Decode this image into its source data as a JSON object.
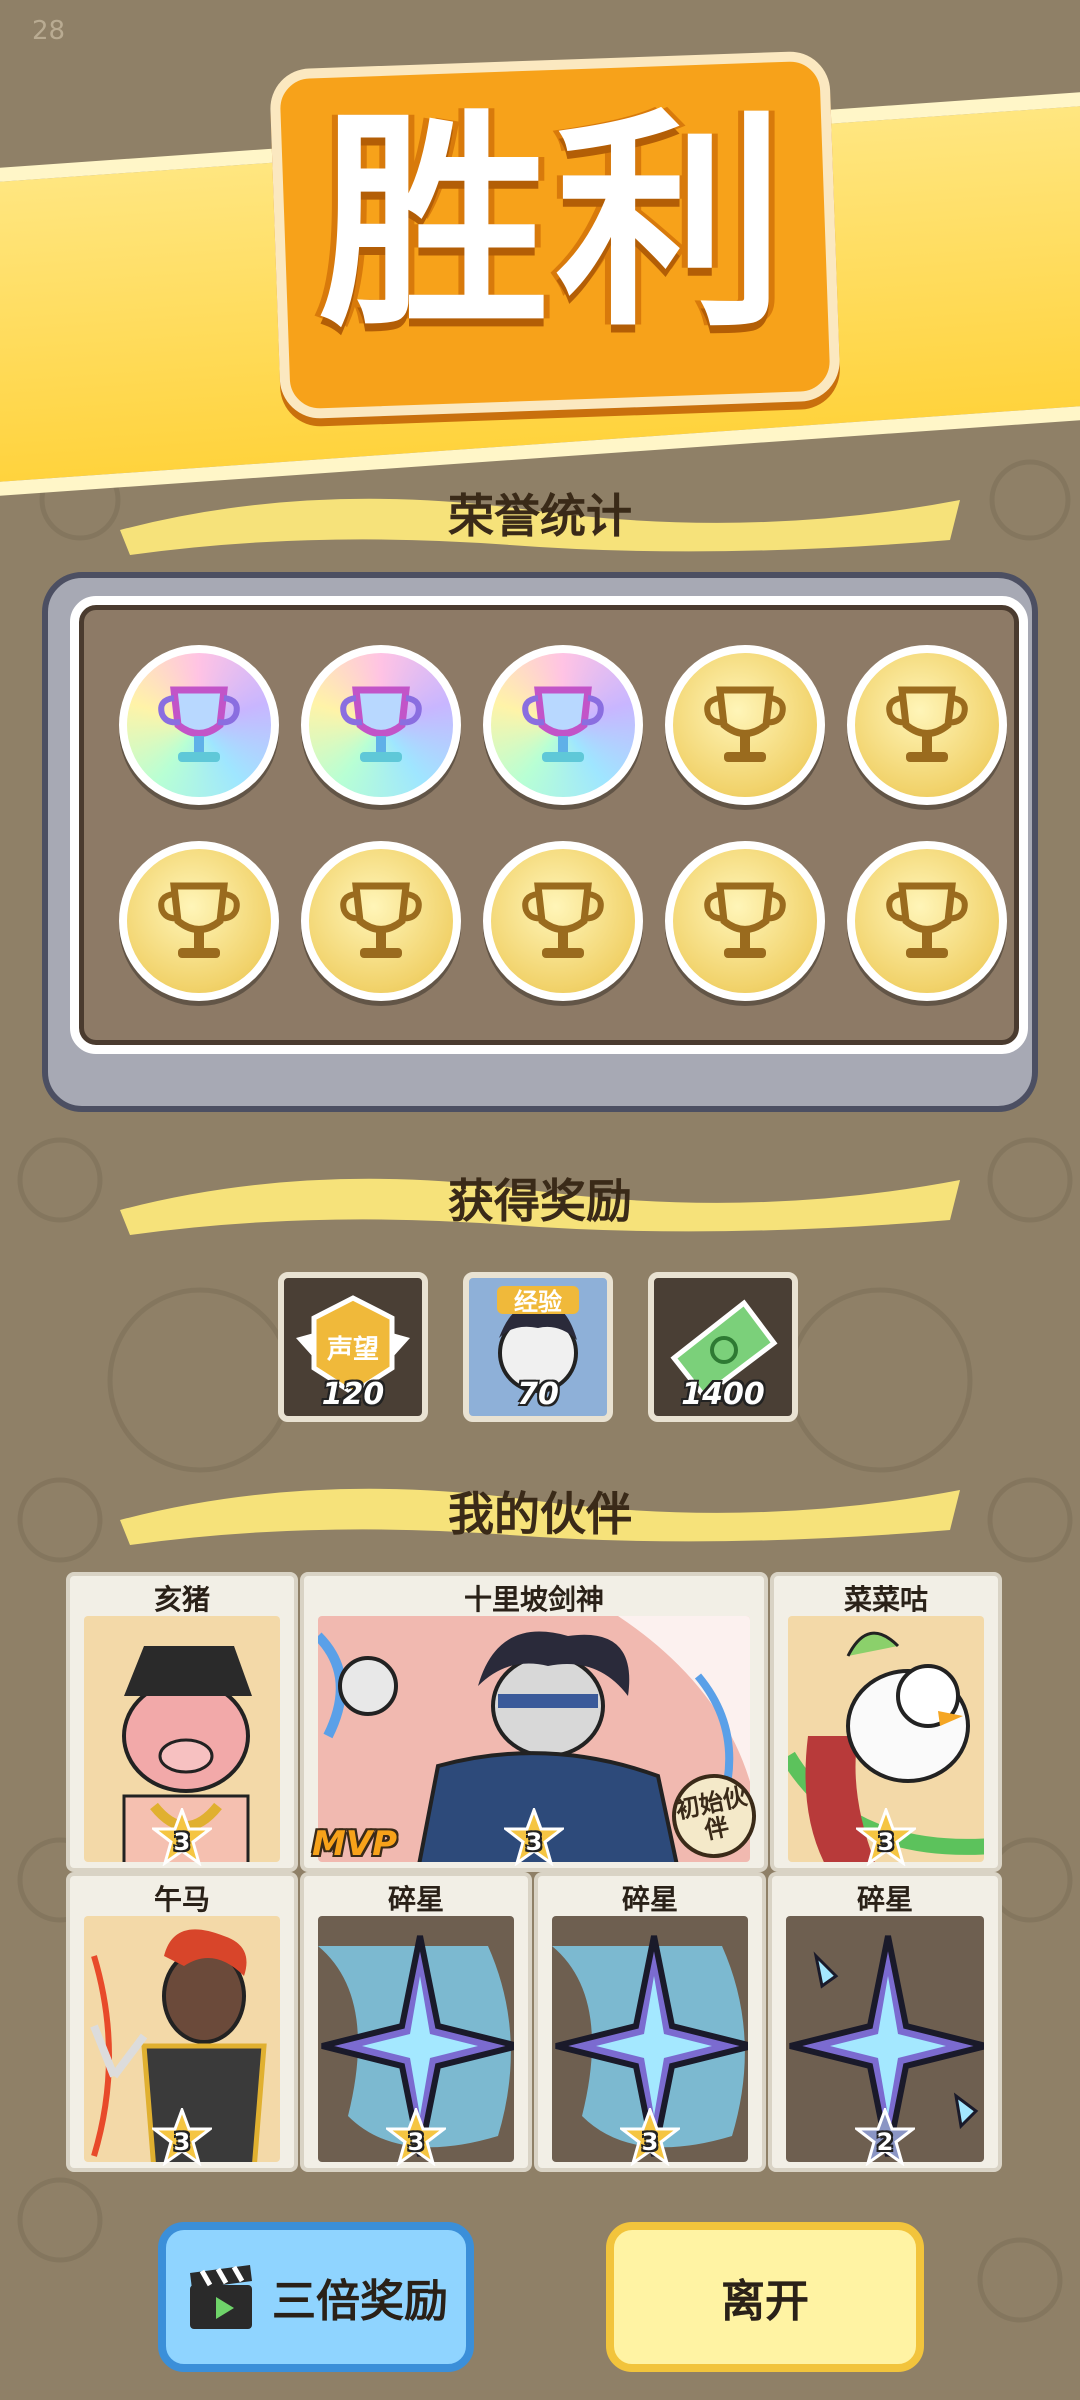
{
  "status": {
    "time": "28"
  },
  "banner": {
    "title": "胜利"
  },
  "honor": {
    "title": "荣誉统计",
    "medals": [
      "rainbow",
      "rainbow",
      "rainbow",
      "gold",
      "gold",
      "gold",
      "gold",
      "gold",
      "gold",
      "gold"
    ]
  },
  "rewards": {
    "title": "获得奖励",
    "items": [
      {
        "icon": "reputation-badge-icon",
        "badge_text": "声望",
        "amount": "120"
      },
      {
        "icon": "experience-character-icon",
        "badge_text": "经验",
        "amount": "70"
      },
      {
        "icon": "cash-icon",
        "amount": "1400"
      }
    ]
  },
  "partners": {
    "title": "我的伙伴",
    "row1": [
      {
        "name": "亥猪",
        "stars": "3"
      },
      {
        "name": "十里坡剑神",
        "stars": "3",
        "mvp": "MVP",
        "tag": "初始伙伴"
      },
      {
        "name": "菜菜咕",
        "stars": "3"
      }
    ],
    "row2": [
      {
        "name": "午马",
        "stars": "3"
      },
      {
        "name": "碎星",
        "stars": "3"
      },
      {
        "name": "碎星",
        "stars": "3"
      },
      {
        "name": "碎星",
        "stars": "2"
      }
    ]
  },
  "buttons": {
    "triple": "三倍奖励",
    "leave": "离开"
  },
  "colors": {
    "background": "#8f8067",
    "banner": "#f7a21a",
    "gold_medal": "#f1d26a",
    "triple_button": "#8fd4ff",
    "leave_button": "#fff3a3"
  }
}
